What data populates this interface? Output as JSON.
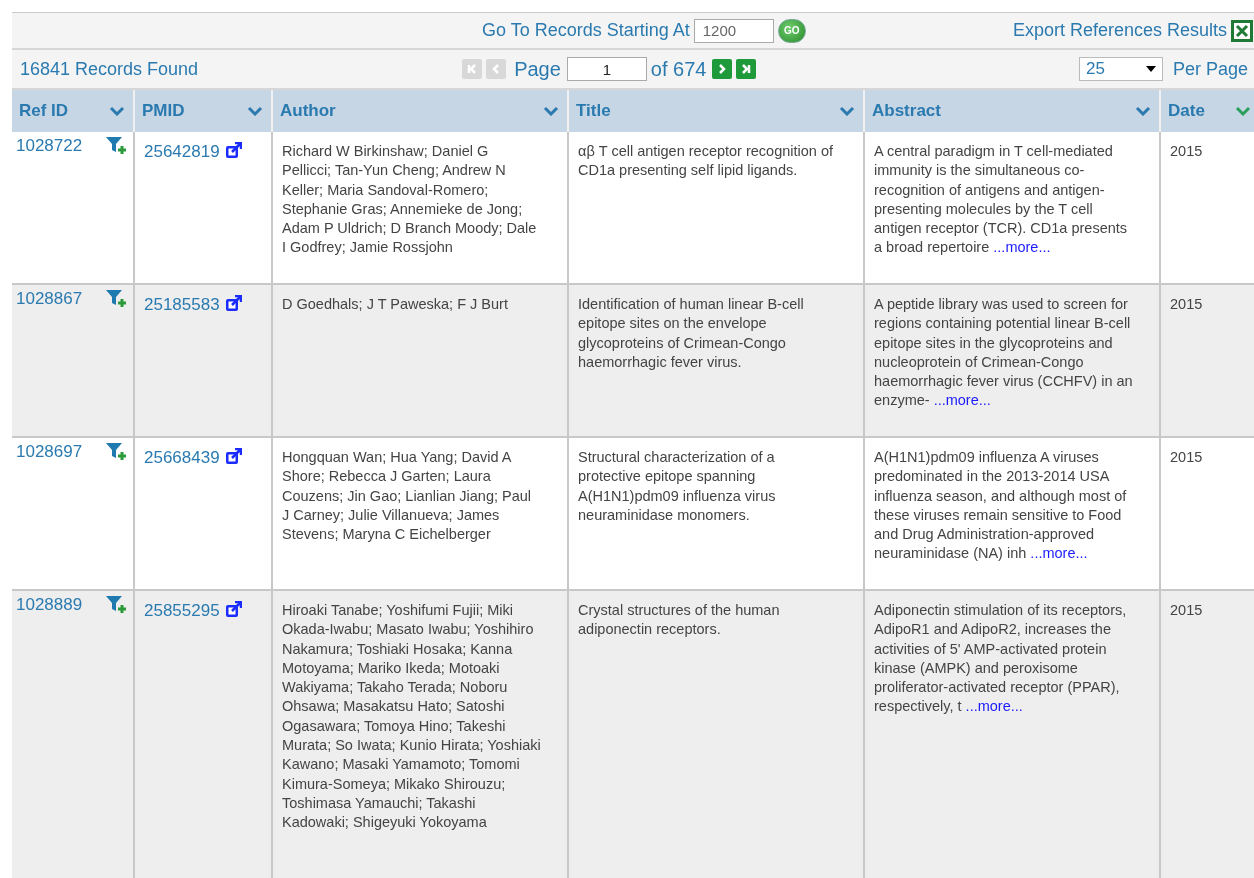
{
  "goto": {
    "label": "Go To Records Starting At",
    "value": "1200",
    "button": "GO"
  },
  "export": {
    "label": "Export References Results"
  },
  "records_found": "16841 Records Found",
  "pager": {
    "first_disabled": true,
    "prev_disabled": true,
    "label": "Page",
    "value": "1",
    "of": "of 674",
    "next_disabled": false,
    "last_disabled": false
  },
  "per_page": {
    "value": "25",
    "label": "Per Page"
  },
  "table": {
    "columns": [
      {
        "label": "Ref ID",
        "sorted": false
      },
      {
        "label": "PMID",
        "sorted": false
      },
      {
        "label": "Author",
        "sorted": false
      },
      {
        "label": "Title",
        "sorted": false
      },
      {
        "label": "Abstract",
        "sorted": false
      },
      {
        "label": "Date",
        "sorted": true
      }
    ],
    "rows": [
      {
        "ref_id": "1028722",
        "pmid": "25642819",
        "author": "Richard W Birkinshaw; Daniel G Pellicci; Tan-Yun Cheng; Andrew N Keller; Maria Sandoval-Romero; Stephanie Gras; Annemieke de Jong; Adam P Uldrich; D Branch Moody; Dale I Godfrey; Jamie Rossjohn",
        "title": "αβ T cell antigen receptor recognition of CD1a presenting self lipid ligands.",
        "abstract": "A central paradigm in T cell-mediated immunity is the simultaneous co-recognition of antigens and antigen-presenting molecules by the T cell antigen receptor (TCR). CD1a presents a broad repertoire",
        "more": "...more...",
        "date": "2015"
      },
      {
        "ref_id": "1028867",
        "pmid": "25185583",
        "author": "D Goedhals; J T Paweska; F J Burt",
        "title": "Identification of human linear B-cell epitope sites on the envelope glycoproteins of Crimean-Congo haemorrhagic fever virus.",
        "abstract": "A peptide library was used to screen for regions containing potential linear B-cell epitope sites in the glycoproteins and nucleoprotein of Crimean-Congo haemorrhagic fever virus (CCHFV) in an enzyme-",
        "more": "...more...",
        "date": "2015"
      },
      {
        "ref_id": "1028697",
        "pmid": "25668439",
        "author": "Hongquan Wan; Hua Yang; David A Shore; Rebecca J Garten; Laura Couzens; Jin Gao; Lianlian Jiang; Paul J Carney; Julie Villanueva; James Stevens; Maryna C Eichelberger",
        "title": "Structural characterization of a protective epitope spanning A(H1N1)pdm09 influenza virus neuraminidase monomers.",
        "abstract": "A(H1N1)pdm09 influenza A viruses predominated in the 2013-2014 USA influenza season, and although most of these viruses remain sensitive to Food and Drug Administration-approved neuraminidase (NA) inh",
        "more": "...more...",
        "date": "2015"
      },
      {
        "ref_id": "1028889",
        "pmid": "25855295",
        "author": "Hiroaki Tanabe; Yoshifumi Fujii; Miki Okada-Iwabu; Masato Iwabu; Yoshihiro Nakamura; Toshiaki Hosaka; Kanna Motoyama; Mariko Ikeda; Motoaki Wakiyama; Takaho Terada; Noboru Ohsawa; Masakatsu Hato; Satoshi Ogasawara; Tomoya Hino; Takeshi Murata; So Iwata; Kunio Hirata; Yoshiaki Kawano; Masaki Yamamoto; Tomomi Kimura-Someya; Mikako Shirouzu; Toshimasa Yamauchi; Takashi Kadowaki; Shigeyuki Yokoyama",
        "title": "Crystal structures of the human adiponectin receptors.",
        "abstract": "Adiponectin stimulation of its receptors, AdipoR1 and AdipoR2, increases the activities of 5' AMP-activated protein kinase (AMPK) and peroxisome proliferator-activated receptor (PPAR), respectively, t",
        "more": "...more...",
        "date": "2015"
      }
    ]
  }
}
